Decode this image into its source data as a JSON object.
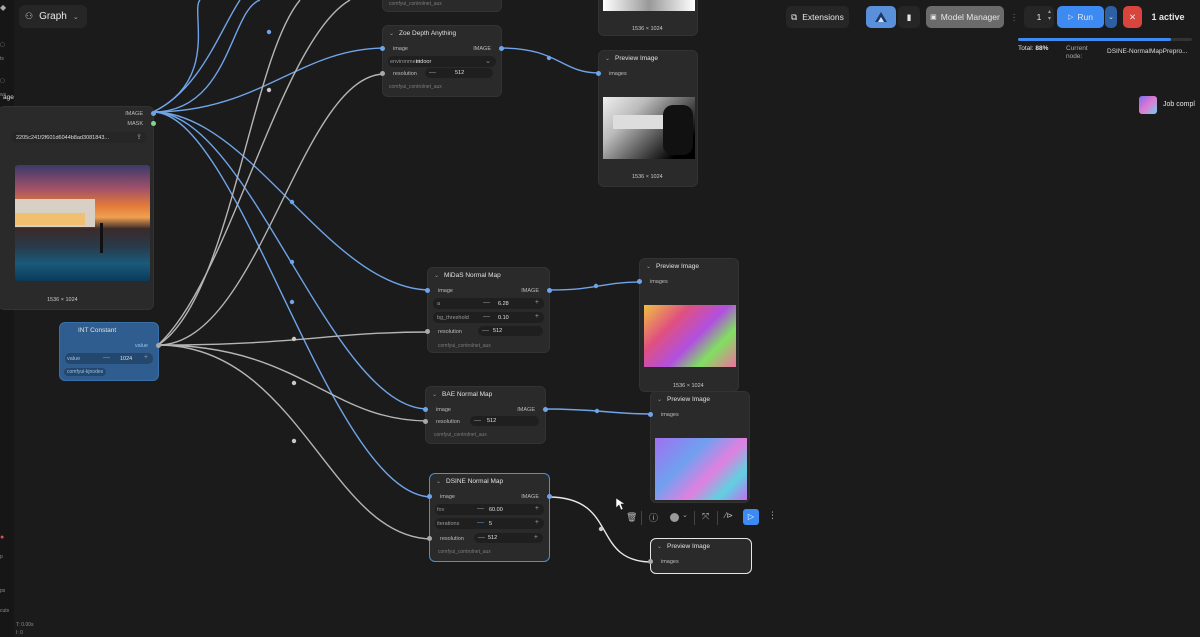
{
  "topbar": {
    "graph_label": "Graph",
    "extensions_label": "Extensions",
    "model_manager_label": "Model Manager",
    "queue_count": "1",
    "run_label": "Run",
    "active_label": "1 active"
  },
  "progress": {
    "total_label": "Total:",
    "total_value": "88%",
    "total_fraction": 0.88,
    "current_label": "Current",
    "node_label": "node:",
    "current_node": "DSINE-NormalMapPrepro..."
  },
  "toast": {
    "text": "Job compl"
  },
  "sidebar": {
    "labels": [
      "ts",
      "ws",
      "ls",
      "odels",
      "dows",
      "s",
      "lates",
      "p",
      "ps",
      "cuts"
    ],
    "status_time": "T: 0.00s",
    "status_i": "I: 0"
  },
  "nodes": {
    "load_image": {
      "title": "age",
      "out_image": "IMAGE",
      "out_mask": "MASK",
      "filename": "2205c241f2f601d6044b8ad3081843...",
      "size": "1536 × 1024"
    },
    "zoe": {
      "title": "Zoe Depth Anything",
      "in_image": "image",
      "out_image": "IMAGE",
      "env_label": "environment",
      "env_value": "indoor",
      "res_label": "resolution",
      "res_value": "512",
      "tag": "comfyui_controlnet_aux",
      "top_tag": "comfyui_controlnet_aux"
    },
    "preview_top": {
      "size": "1536 × 1024"
    },
    "preview1": {
      "title": "Preview Image",
      "in_images": "images",
      "size": "1536 × 1024"
    },
    "midas": {
      "title": "MiDaS Normal Map",
      "in_image": "image",
      "out_image": "IMAGE",
      "a_label": "a",
      "a_value": "6.28",
      "bg_label": "bg_threshold",
      "bg_value": "0.10",
      "res_label": "resolution",
      "res_value": "512",
      "tag": "comfyui_controlnet_aux"
    },
    "preview2": {
      "title": "Preview Image",
      "in_images": "images",
      "size": "1536 × 1024"
    },
    "int_const": {
      "title": "INT Constant",
      "out_value": "value",
      "value_label": "value",
      "value": "1024",
      "tag": "comfyui-kjnodes"
    },
    "bae": {
      "title": "BAE Normal Map",
      "in_image": "image",
      "out_image": "IMAGE",
      "res_label": "resolution",
      "res_value": "512",
      "tag": "comfyui_controlnet_aux"
    },
    "preview3": {
      "title": "Preview Image",
      "in_images": "images"
    },
    "dsine": {
      "title": "DSINE Normal Map",
      "in_image": "image",
      "out_image": "IMAGE",
      "fov_label": "fov",
      "fov_value": "60.00",
      "iter_label": "iterations",
      "iter_value": "5",
      "res_label": "resolution",
      "res_value": "512",
      "tag": "comfyui_controlnet_aux"
    },
    "preview4": {
      "title": "Preview Image",
      "in_images": "images"
    }
  },
  "icons": [
    "graph-icon",
    "chevron-down-icon",
    "extensions-icon",
    "bookmark-icon",
    "play-icon",
    "close-icon",
    "trash-icon",
    "info-icon",
    "color-dot-icon",
    "fit-icon",
    "bypass-icon",
    "more-icon",
    "cursor-icon"
  ],
  "colors": {
    "accent_blue": "#3d8bf2",
    "image_port": "#6fa4e8",
    "mask_port": "#7ad98a",
    "selected_border": "#4a8fd8",
    "int_node": "#2f5d8f",
    "close_red": "#d9443d"
  }
}
